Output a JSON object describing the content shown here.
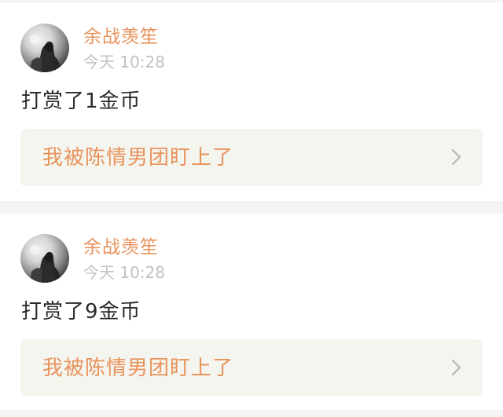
{
  "posts": [
    {
      "username": "余战羡笙",
      "time": "今天 10:28",
      "message": "打赏了1金币",
      "link_title": "我被陈情男团盯上了"
    },
    {
      "username": "余战羡笙",
      "time": "今天 10:28",
      "message": "打赏了9金币",
      "link_title": "我被陈情男团盯上了"
    }
  ],
  "icons": {
    "avatar": "avatar-image",
    "chevron": "chevron-right-icon"
  },
  "colors": {
    "username": "#e8935c",
    "time": "#c2c2c2",
    "message": "#2a2a2a",
    "link_background": "#f5f5f0",
    "link_text": "#e8935c",
    "page_background": "#f4f4f4",
    "card_background": "#ffffff",
    "chevron": "#b5b5b5"
  }
}
